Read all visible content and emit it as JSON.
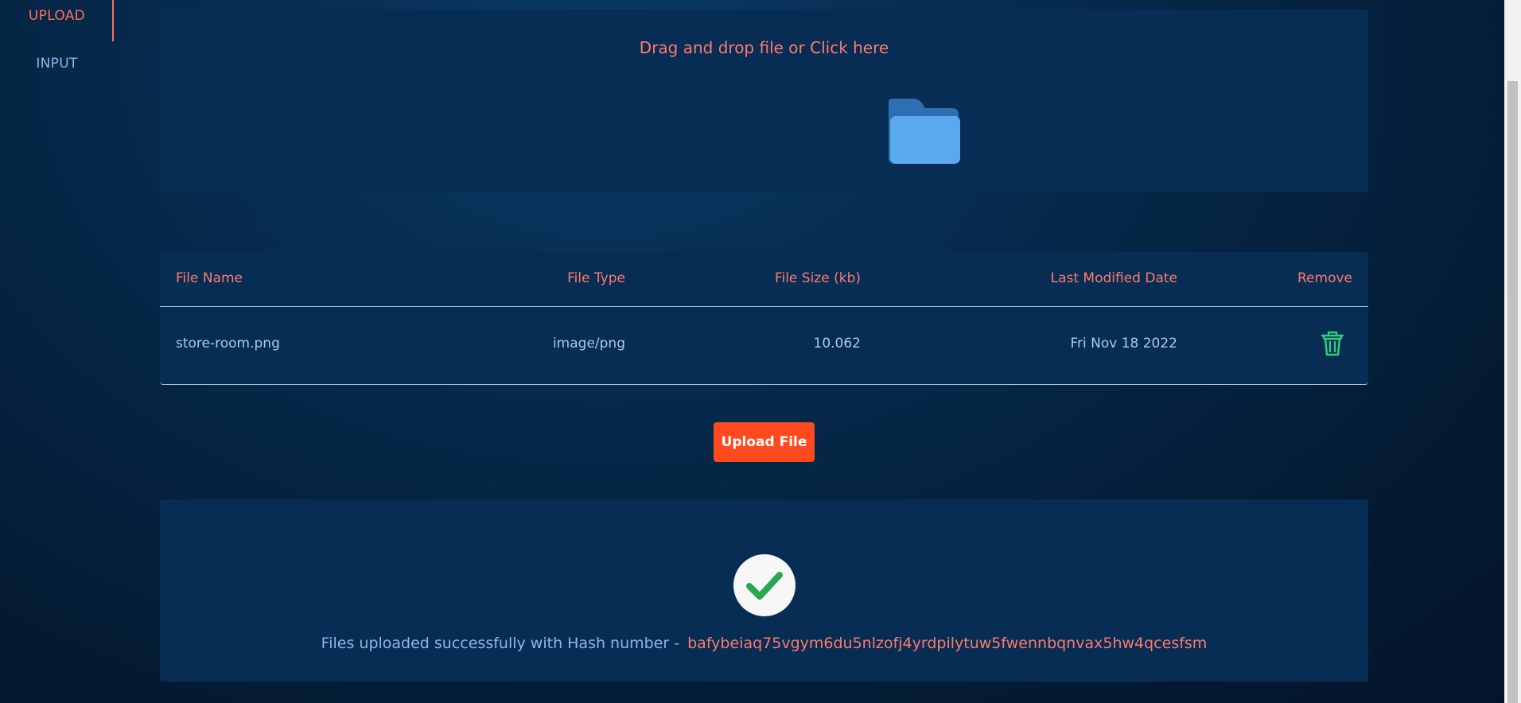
{
  "sidebar": {
    "items": [
      {
        "label": "UPLOAD",
        "active": true
      },
      {
        "label": "INPUT",
        "active": false
      }
    ]
  },
  "drop_zone": {
    "text": "Drag and drop file or Click here",
    "icon": "folder-icon"
  },
  "table": {
    "headers": [
      "File Name",
      "File Type",
      "File Size (kb)",
      "Last Modified Date",
      "Remove"
    ],
    "rows": [
      {
        "name": "store-room.png",
        "type": "image/png",
        "size": "10.062",
        "modified": "Fri Nov 18 2022",
        "remove_icon": "trash-icon"
      }
    ]
  },
  "upload_button": {
    "label": "Upload File"
  },
  "result": {
    "icon": "check-circle-icon",
    "message": "Files uploaded successfully with Hash number -",
    "hash": "bafybeiaq75vgym6du5nlzofj4yrdpilytuw5fwennbqnvax5hw4qcesfsm"
  },
  "colors": {
    "accent": "#ff7a6a",
    "button": "#ff4a1f",
    "panel": "#072d55",
    "muted_text": "#8fb6e6",
    "success": "#27a851"
  }
}
